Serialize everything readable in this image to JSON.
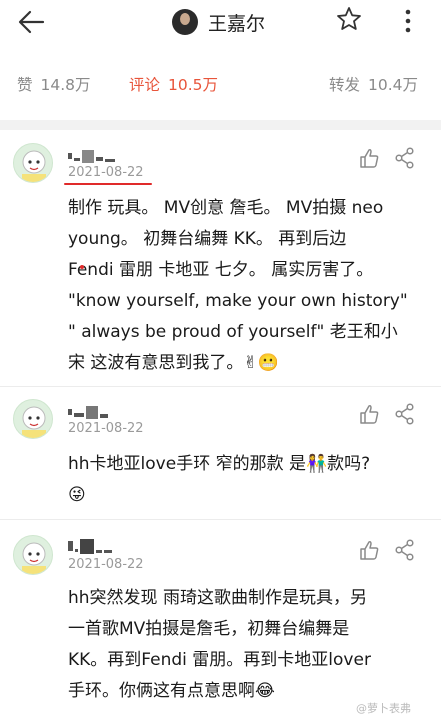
{
  "header": {
    "title": "王嘉尔",
    "back_icon": "back-arrow-icon",
    "star_icon": "star-icon",
    "more_icon": "more-vertical-icon"
  },
  "stats": {
    "likes_label": "赞",
    "likes_count": "14.8万",
    "comments_label": "评论",
    "comments_count": "10.5万",
    "reposts_label": "转发",
    "reposts_count": "10.4万",
    "active_color": "#e8553b"
  },
  "comments": [
    {
      "date": "2021-08-22",
      "lines": [
        "制作 玩具。 MV创意 詹毛。 MV拍摄 neo",
        "young。 初舞台编舞 KK。 再到后边",
        "Fendi 雷朋 卡地亚 七夕。 属实厉害了。",
        "\"know yourself, make your own history\"",
        "\" always be proud of yourself\" 老王和小",
        "宋 这波有意思到我了。✌😬"
      ]
    },
    {
      "date": "2021-08-22",
      "lines": [
        "hh卡地亚love手环 窄的那款 是👫款吗?",
        "😜"
      ]
    },
    {
      "date": "2021-08-22",
      "lines": [
        "hh突然发现 雨琦这歌曲制作是玩具，另",
        "一首歌MV拍摄是詹毛，初舞台编舞是",
        "KK。再到Fendi 雷朋。再到卡地亚lover",
        "手环。你俩这有点意思啊😂"
      ]
    }
  ],
  "watermark": "@萝卜表弗"
}
